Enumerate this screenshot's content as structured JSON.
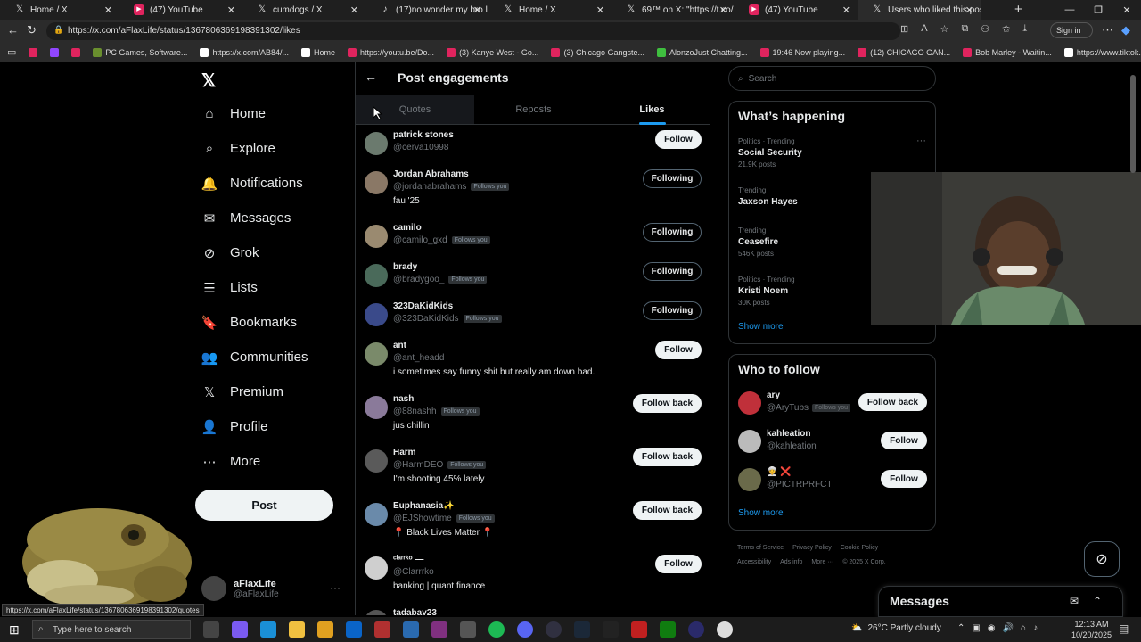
{
  "browser": {
    "tabs": [
      {
        "title": "Home / X",
        "icon": "x-icon"
      },
      {
        "title": "(47) YouTube",
        "icon": "youtube-icon"
      },
      {
        "title": "cumdogs / X",
        "icon": "x-icon"
      },
      {
        "title": "(17)no wonder my bro look",
        "icon": "tiktok-icon"
      },
      {
        "title": "Home / X",
        "icon": "x-icon"
      },
      {
        "title": "69™ on X: \"https://t.co/",
        "icon": "x-icon"
      },
      {
        "title": "(47) YouTube",
        "icon": "youtube-icon"
      },
      {
        "title": "Users who liked this post /",
        "icon": "x-icon"
      }
    ],
    "url": "https://x.com/aFlaxLife/status/1367806369198391302/likes",
    "signin_label": "Sign in",
    "bookmarks": [
      {
        "label": "",
        "color": "#e0245e"
      },
      {
        "label": "",
        "color": "#9146ff"
      },
      {
        "label": "",
        "color": "#e0245e"
      },
      {
        "label": "PC Games, Software...",
        "color": "#6a8f2e"
      },
      {
        "label": "https://x.com/AB84/...",
        "color": "#ffffff"
      },
      {
        "label": "Home",
        "color": "#ffffff"
      },
      {
        "label": "https://youtu.be/Do...",
        "color": "#e0245e"
      },
      {
        "label": "(3) Kanye West - Go...",
        "color": "#e0245e"
      },
      {
        "label": "(3) Chicago Gangste...",
        "color": "#e0245e"
      },
      {
        "label": "AlonzoJust Chatting...",
        "color": "#3fbf3f"
      },
      {
        "label": "19:46 Now playing...",
        "color": "#e0245e"
      },
      {
        "label": "(12) CHICAGO GAN...",
        "color": "#e0245e"
      },
      {
        "label": "Bob Marley - Waitin...",
        "color": "#e0245e"
      },
      {
        "label": "https://www.tiktok.c...",
        "color": "#ffffff"
      }
    ],
    "status_url": "https://x.com/aFlaxLife/status/1367806369198391302/quotes"
  },
  "left_nav": {
    "items": [
      {
        "label": "Home",
        "icon": "home-icon",
        "glyph": "⌂"
      },
      {
        "label": "Explore",
        "icon": "search-icon",
        "glyph": "⌕"
      },
      {
        "label": "Notifications",
        "icon": "bell-icon",
        "glyph": "🔔"
      },
      {
        "label": "Messages",
        "icon": "envelope-icon",
        "glyph": "✉"
      },
      {
        "label": "Grok",
        "icon": "grok-icon",
        "glyph": "⊘"
      },
      {
        "label": "Lists",
        "icon": "list-icon",
        "glyph": "☰"
      },
      {
        "label": "Bookmarks",
        "icon": "bookmark-icon",
        "glyph": "🔖"
      },
      {
        "label": "Communities",
        "icon": "people-icon",
        "glyph": "👥"
      },
      {
        "label": "Premium",
        "icon": "x-icon",
        "glyph": "𝕏"
      },
      {
        "label": "Profile",
        "icon": "person-icon",
        "glyph": "👤"
      },
      {
        "label": "More",
        "icon": "more-circle-icon",
        "glyph": "⋯"
      }
    ],
    "post_label": "Post",
    "profile": {
      "name": "aFlaxLife",
      "handle": "@aFlaxLife"
    }
  },
  "main": {
    "title": "Post engagements",
    "tabs": [
      {
        "label": "Quotes",
        "active": false
      },
      {
        "label": "Reposts",
        "active": false
      },
      {
        "label": "Likes",
        "active": true
      }
    ],
    "users": [
      {
        "name": "patrick stones",
        "handle": "@cerva10998",
        "follows_you": false,
        "bio": "",
        "button": "Follow",
        "avatar_color": "#6b7a6e"
      },
      {
        "name": "Jordan Abrahams",
        "handle": "@jordanabrahams",
        "follows_you": true,
        "bio": "fau '25",
        "button": "Following",
        "avatar_color": "#8a7866"
      },
      {
        "name": "camilo",
        "handle": "@camilo_gxd",
        "follows_you": true,
        "bio": "",
        "button": "Following",
        "avatar_color": "#9a8a70"
      },
      {
        "name": "brady",
        "handle": "@bradygoo_",
        "follows_you": true,
        "bio": "",
        "button": "Following",
        "avatar_color": "#4a6a5a"
      },
      {
        "name": "323DaKidKids",
        "handle": "@323DaKidKids",
        "follows_you": true,
        "bio": "",
        "button": "Following",
        "avatar_color": "#3a4a8a"
      },
      {
        "name": "ant",
        "handle": "@ant_headd",
        "follows_you": false,
        "bio": "i sometimes say funny shit but really am down bad.",
        "button": "Follow",
        "avatar_color": "#7a8a6a"
      },
      {
        "name": "nash",
        "handle": "@88nashh",
        "follows_you": true,
        "bio": "jus chillin",
        "button": "Follow back",
        "avatar_color": "#8a7a9a"
      },
      {
        "name": "Harm",
        "handle": "@HarmDEO",
        "follows_you": true,
        "bio": "I'm shooting 45% lately",
        "button": "Follow back",
        "avatar_color": "#5a5a5a"
      },
      {
        "name": "Euphanasia✨",
        "handle": "@EJShowtime",
        "follows_you": true,
        "bio": "📍 Black Lives Matter 📍",
        "button": "Follow back",
        "avatar_color": "#6a8aaa"
      },
      {
        "name": "ᶜˡᵃʳʳᵏᵒ —",
        "handle": "@Clarrrko",
        "follows_you": false,
        "bio": "banking | quant finance",
        "button": "Follow",
        "avatar_color": "#cfcfcf"
      },
      {
        "name": "tadabay23",
        "handle": "",
        "follows_you": false,
        "bio": "",
        "button": "",
        "avatar_color": "#555555"
      }
    ],
    "follows_you_label": "Follows you"
  },
  "sidebar": {
    "search_placeholder": "Search",
    "whats_happening": {
      "title": "What’s happening",
      "trends": [
        {
          "context": "Politics · Trending",
          "title": "Social Security",
          "count": "21.9K posts"
        },
        {
          "context": "Trending",
          "title": "Jaxson Hayes",
          "count": ""
        },
        {
          "context": "Trending",
          "title": "Ceasefire",
          "count": "546K posts"
        },
        {
          "context": "Politics · Trending",
          "title": "Kristi Noem",
          "count": "30K posts"
        }
      ],
      "show_more": "Show more"
    },
    "who_to_follow": {
      "title": "Who to follow",
      "users": [
        {
          "name": "ary",
          "handle": "@AryTubs",
          "follows_you": true,
          "button": "Follow back",
          "avatar_color": "#c0303a"
        },
        {
          "name": "kahleation",
          "handle": "@kahleation",
          "follows_you": false,
          "button": "Follow",
          "avatar_color": "#bbbbbb"
        },
        {
          "name": "👳 ❌",
          "handle": "@PICTRPRFCT",
          "follows_you": false,
          "button": "Follow",
          "avatar_color": "#6a6a4a"
        }
      ],
      "show_more": "Show more"
    },
    "footer": [
      "Terms of Service",
      "Privacy Policy",
      "Cookie Policy",
      "Accessibility",
      "Ads info",
      "More ···",
      "© 2025 X Corp."
    ],
    "messages_label": "Messages"
  },
  "taskbar": {
    "search_placeholder": "Type here to search",
    "weather": "26°C  Partly cloudy",
    "time": "12:13 AM",
    "date": "10/20/2025"
  }
}
